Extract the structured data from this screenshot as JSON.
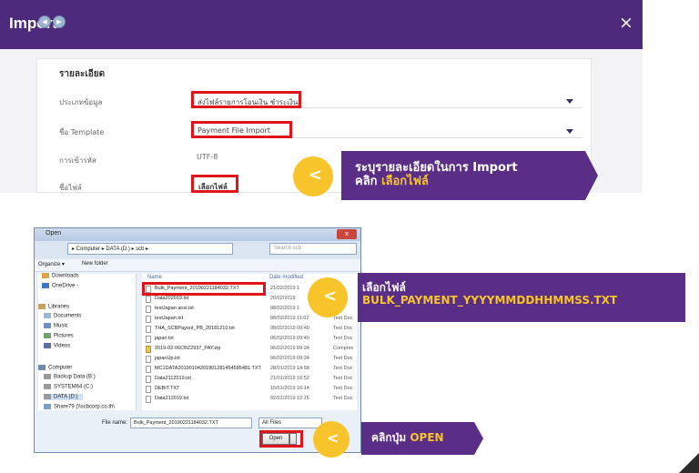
{
  "import_window": {
    "title": "Import",
    "close_glyph": "×",
    "card_title": "รายละเอียด",
    "rows": [
      {
        "label": "ประเภทข้อมูล",
        "value": "ส่งไฟล์รายการโอนเงิน ชำระเงิน"
      },
      {
        "label": "ชื่อ Template",
        "value": "Payment File Import"
      },
      {
        "label": "การเข้ารหัส",
        "value": "UTF-8"
      },
      {
        "label": "ชื่อไฟล์",
        "value": "เลือกไฟล์"
      }
    ]
  },
  "callouts": [
    {
      "line1": "ระบุรายละเอียดในการ Import",
      "line2_prefix": "คลิก ",
      "line2_highlight": "เลือกไฟล์"
    },
    {
      "line1": "เลือกไฟล์",
      "line2_prefix": "",
      "line2_highlight": "BULK_PAYMENT_YYYYMMDDHHMMSS.TXT"
    },
    {
      "line1": "",
      "line2_prefix": "คลิกปุ่ม ",
      "line2_highlight": "OPEN"
    }
  ],
  "callout_chevron": "<",
  "open_dialog": {
    "title": "Open",
    "close_glyph": "x",
    "back_glyph": "◀",
    "fwd_glyph": "▶",
    "address": "▸ Computer ▸ DATA (D:) ▸ scb ▸",
    "search_placeholder": "Search scb",
    "toolbar": {
      "organize": "Organize ▾",
      "new_folder": "New folder"
    },
    "nav_items": [
      {
        "label": "Downloads",
        "color": "#d9a441"
      },
      {
        "label": "OneDrive -",
        "color": "#3b78c9"
      },
      {
        "label": "Libraries",
        "color": "#c9a15a"
      },
      {
        "label": "Documents",
        "color": "#9db6d6"
      },
      {
        "label": "Music",
        "color": "#6d8fc2"
      },
      {
        "label": "Pictures",
        "color": "#6fa36b"
      },
      {
        "label": "Videos",
        "color": "#5b6fa3"
      },
      {
        "label": "Computer",
        "color": "#6f8aaa"
      },
      {
        "label": "Backup Data (B:)",
        "color": "#9a9a9a"
      },
      {
        "label": "SYSTEM64 (C:)",
        "color": "#9a9a9a"
      },
      {
        "label": "DATA (D:)",
        "color": "#9a9a9a"
      },
      {
        "label": "Share79 (\\\\scbcorp.co.th\\",
        "color": "#7aa0c8"
      }
    ],
    "columns": {
      "name": "Name",
      "date": "Date modified"
    },
    "files": [
      {
        "name": "Bulk_Payment_20190221184032.TXT",
        "date": "21/02/2019 1",
        "type": ""
      },
      {
        "name": "Data202019.txt",
        "date": "20/02/2019",
        "type": ""
      },
      {
        "name": "testJapan ansi.txt",
        "date": "08/02/2019 1",
        "type": ""
      },
      {
        "name": "testJapan.txt",
        "date": "08/02/2019 11:02",
        "type": "Text Doc"
      },
      {
        "name": "THA_SCBPayout_PB_20181210.txt",
        "date": "08/02/2019 09:40",
        "type": "Text Doc"
      },
      {
        "name": "japan.txt",
        "date": "06/02/2019 09:40",
        "type": "Text Doc"
      },
      {
        "name": "2019-02-06CBZ2937_PAY.zip",
        "date": "06/02/2019 09:34",
        "type": "Compres"
      },
      {
        "name": "japanUp.txt",
        "date": "06/02/2019 09:34",
        "type": "Text Doc"
      },
      {
        "name": "MC1DATA20190104201901281454585481.TXT",
        "date": "28/01/2019 14:58",
        "type": "Text Doc"
      },
      {
        "name": "Data2112019.txt",
        "date": "21/01/2019 16:52",
        "type": "Text Doc"
      },
      {
        "name": "DEBIT.TXT",
        "date": "15/01/2019 16:14",
        "type": "Text Doc"
      },
      {
        "name": "Data212019.txt",
        "date": "02/01/2019 12:15",
        "type": "Text Doc"
      }
    ],
    "file_name_label": "File name:",
    "file_name_value": "Bulk_Payment_20190221184032.TXT",
    "file_type": "All Files",
    "open_button": "Open"
  }
}
